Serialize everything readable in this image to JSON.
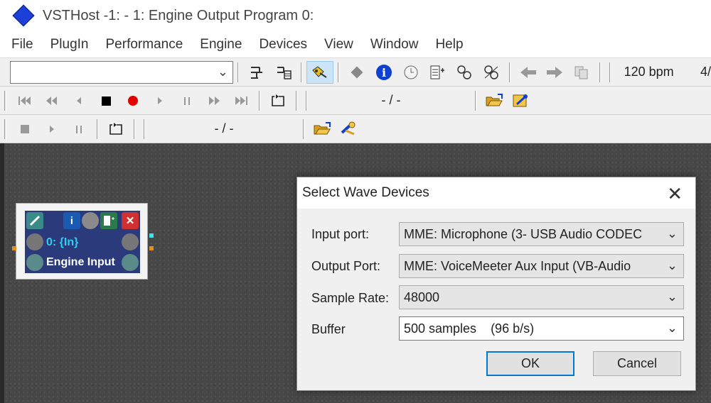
{
  "window": {
    "title": "VSTHost -1:  - 1: Engine Output Program 0:"
  },
  "menu": [
    "File",
    "PlugIn",
    "Performance",
    "Engine",
    "Devices",
    "View",
    "Window",
    "Help"
  ],
  "toolbar1": {
    "bpm": "120 bpm",
    "signature": "4/"
  },
  "toolbar2": {
    "position": "- / -"
  },
  "toolbar3": {
    "position": "- / -"
  },
  "plugin": {
    "line1": "0: {In}",
    "line2": "Engine Input"
  },
  "dialog": {
    "title": "Select Wave Devices",
    "input_label": "Input port:",
    "input_value": "MME: Microphone (3- USB Audio CODEC",
    "output_label": "Output Port:",
    "output_value": "MME: VoiceMeeter Aux Input (VB-Audio",
    "rate_label": "Sample Rate:",
    "rate_value": "48000",
    "buffer_label": "Buffer",
    "buffer_value": "500 samples    (96 b/s)",
    "ok": "OK",
    "cancel": "Cancel"
  }
}
